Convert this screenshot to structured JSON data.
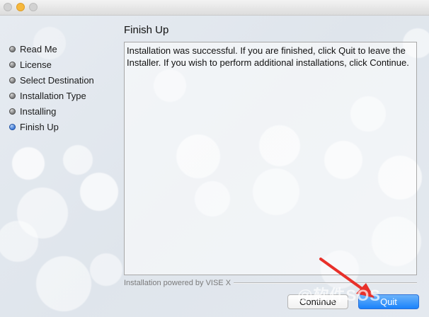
{
  "window": {
    "traffic_lights": [
      "close",
      "minimize",
      "zoom"
    ]
  },
  "sidebar": {
    "items": [
      {
        "label": "Read Me",
        "current": false
      },
      {
        "label": "License",
        "current": false
      },
      {
        "label": "Select Destination",
        "current": false
      },
      {
        "label": "Installation Type",
        "current": false
      },
      {
        "label": "Installing",
        "current": false
      },
      {
        "label": "Finish Up",
        "current": true
      }
    ]
  },
  "main": {
    "title": "Finish Up",
    "message": "Installation was successful. If you are finished, click Quit to leave the Installer. If you wish to perform additional installations, click Continue."
  },
  "footer": {
    "powered_by": "Installation powered by VISE X"
  },
  "buttons": {
    "continue_label": "Continue",
    "quit_label": "Quit"
  },
  "watermark": {
    "text": "@软件SOS"
  },
  "colors": {
    "accent": "#1a82fb",
    "annotation_arrow": "#e8302a"
  }
}
